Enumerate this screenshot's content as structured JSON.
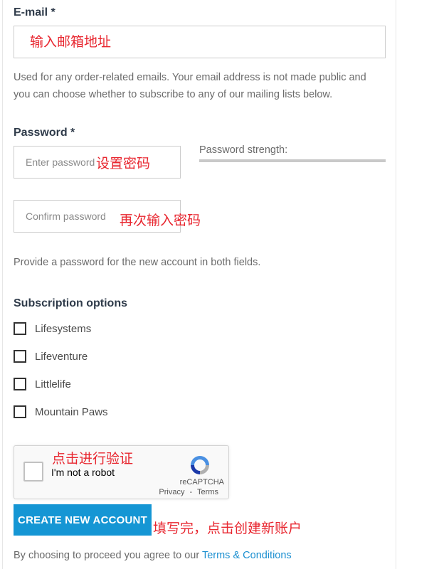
{
  "email": {
    "label": "E-mail *",
    "annotation": "输入邮箱地址",
    "help": "Used for any order-related emails. Your email address is not made public and you can choose whether to subscribe to any of our mailing lists below."
  },
  "password": {
    "label": "Password *",
    "placeholder": "Enter password",
    "annotation": "设置密码",
    "strength_label": "Password strength:",
    "confirm_placeholder": "Confirm password",
    "confirm_annotation": "再次输入密码",
    "help": "Provide a password for the new account in both fields."
  },
  "subscriptions": {
    "label": "Subscription options",
    "options": [
      {
        "label": "Lifesystems",
        "checked": false
      },
      {
        "label": "Lifeventure",
        "checked": false
      },
      {
        "label": "Littlelife",
        "checked": false
      },
      {
        "label": "Mountain Paws",
        "checked": false
      }
    ]
  },
  "recaptcha": {
    "annotation": "点击进行验证",
    "text": "I'm not a robot",
    "brand": "reCAPTCHA",
    "privacy": "Privacy",
    "separator": "-",
    "terms": "Terms"
  },
  "submit": {
    "label": "CREATE NEW ACCOUNT",
    "annotation": "填写完，点击创建新账户"
  },
  "agreement": {
    "text": "By choosing to proceed you agree to our",
    "link": "Terms & Conditions"
  },
  "colors": {
    "button": "#1596d4",
    "annotation": "#e8262f",
    "link": "#1b8fd0"
  }
}
